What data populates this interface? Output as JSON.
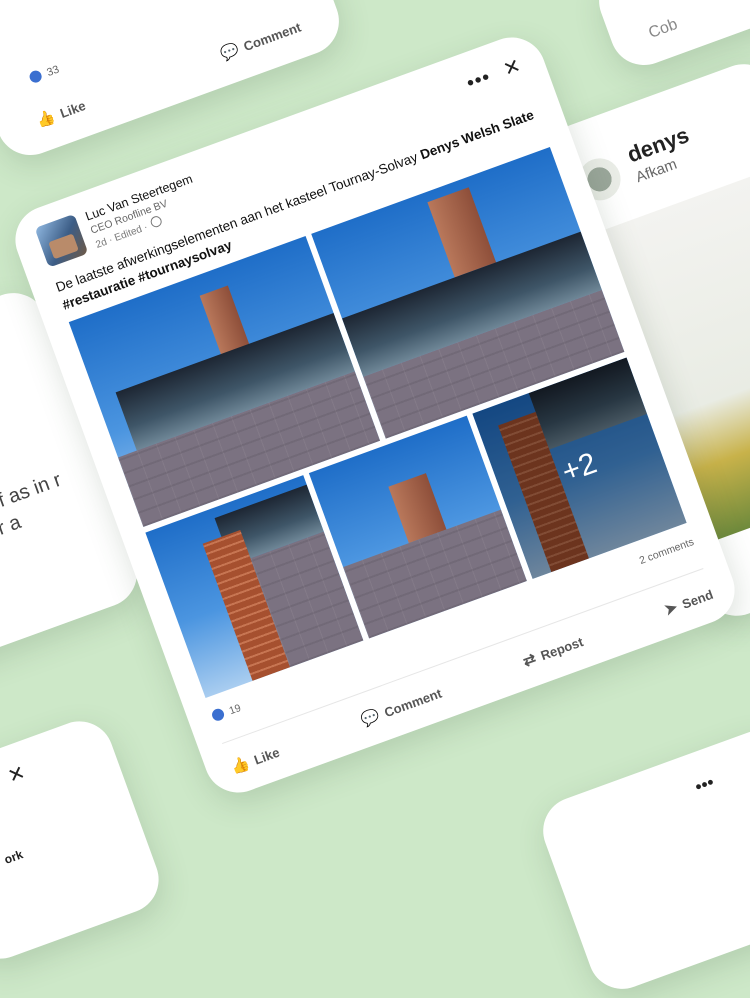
{
  "post": {
    "author": "Luc Van Steertegem",
    "headline": "CEO Roofline BV",
    "meta": "2d · Edited ·",
    "caption_text": "De laatste afwerkingselementen aan het kasteel Tournay-Solvay",
    "caption_bold": "Denys Welsh Slate #restauratie #tournaysolvay",
    "more_images": "+2",
    "reactions": "19",
    "comments_count": "2 comments",
    "actions": {
      "like": "Like",
      "comment": "Comment",
      "repost": "Repost",
      "send": "Send"
    }
  },
  "top_card": {
    "reactions": "33",
    "like": "Like",
    "comment": "Comment"
  },
  "top_right_card": {
    "text": "Cob"
  },
  "right_card": {
    "name": "denys",
    "subtitle": "Afkam"
  },
  "left_card": {
    "text": "y of as in r for a"
  },
  "bottom_left_card": {
    "text": "ork"
  },
  "colors": {
    "background": "#cde8c8",
    "reaction_blue": "#3b6fd0"
  }
}
